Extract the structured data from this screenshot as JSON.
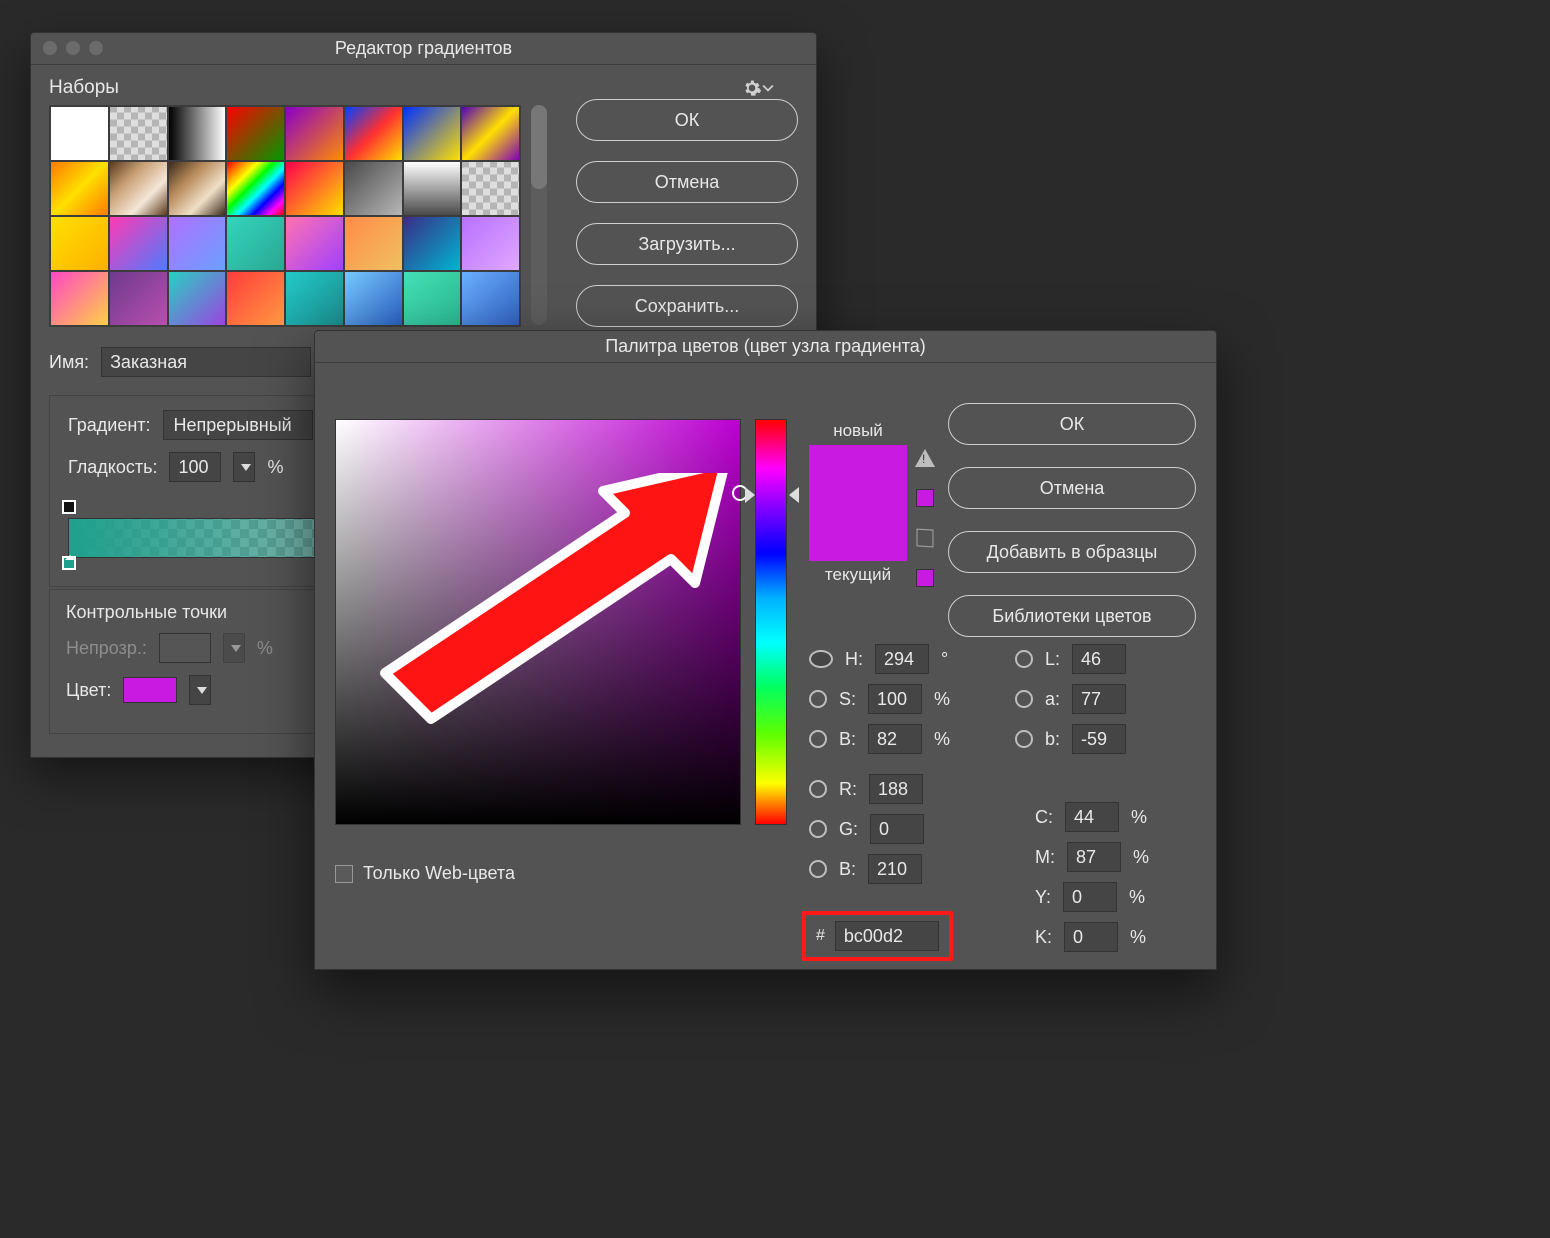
{
  "gradient_editor": {
    "title": "Редактор градиентов",
    "presets_label": "Наборы",
    "buttons": {
      "ok": "ОК",
      "cancel": "Отмена",
      "load": "Загрузить...",
      "save": "Сохранить..."
    },
    "name_label": "Имя:",
    "name_value": "Заказная",
    "gradient_label": "Градиент:",
    "gradient_type": "Непрерывный",
    "smoothness_label": "Гладкость:",
    "smoothness_value": "100",
    "percent": "%",
    "stops_title": "Контрольные точки",
    "opacity_label": "Непрозр.:",
    "color_label": "Цвет:"
  },
  "color_picker": {
    "title": "Палитра цветов (цвет узла градиента)",
    "buttons": {
      "ok": "ОК",
      "cancel": "Отмена",
      "add": "Добавить в образцы",
      "libs": "Библиотеки цветов"
    },
    "new_label": "новый",
    "current_label": "текущий",
    "only_web": "Только Web-цвета",
    "deg": "°",
    "percent": "%",
    "hash": "#",
    "labels": {
      "H": "H:",
      "S": "S:",
      "B": "B:",
      "R": "R:",
      "G": "G:",
      "Bch": "B:",
      "L": "L:",
      "a": "a:",
      "b": "b:",
      "C": "C:",
      "M": "M:",
      "Y": "Y:",
      "K": "K:"
    },
    "values": {
      "H": "294",
      "S": "100",
      "B": "82",
      "R": "188",
      "G": "0",
      "Bch": "210",
      "L": "46",
      "a": "77",
      "b": "-59",
      "C": "44",
      "M": "87",
      "Y": "0",
      "K": "0",
      "hex": "bc00d2"
    },
    "preview_hex": "#c81ae0"
  }
}
